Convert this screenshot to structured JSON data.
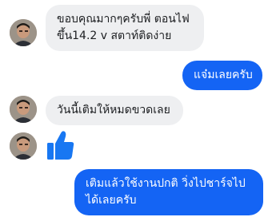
{
  "messages": [
    {
      "from": "other",
      "text_line1": "ขอบคุณมากๆครับพี่ ตอนไฟ",
      "text_line2": "ขึ้น14.2 v สตาท์ติดง่าย"
    },
    {
      "from": "me",
      "text": "แจ๋มเลยครับ"
    },
    {
      "from": "other",
      "text": "วันนี้เติมให้หมดขวดเลย"
    },
    {
      "from": "other",
      "content": "like-icon"
    },
    {
      "from": "me",
      "text_line1": "เติมแล้วใช้งานปกติ วิ่งไปชาร์จไป",
      "text_line2": "ได้เลยครับ"
    }
  ],
  "colors": {
    "incoming_bubble": "#eeeff1",
    "outgoing_bubble": "#1464f4",
    "like": "#1877f2"
  }
}
